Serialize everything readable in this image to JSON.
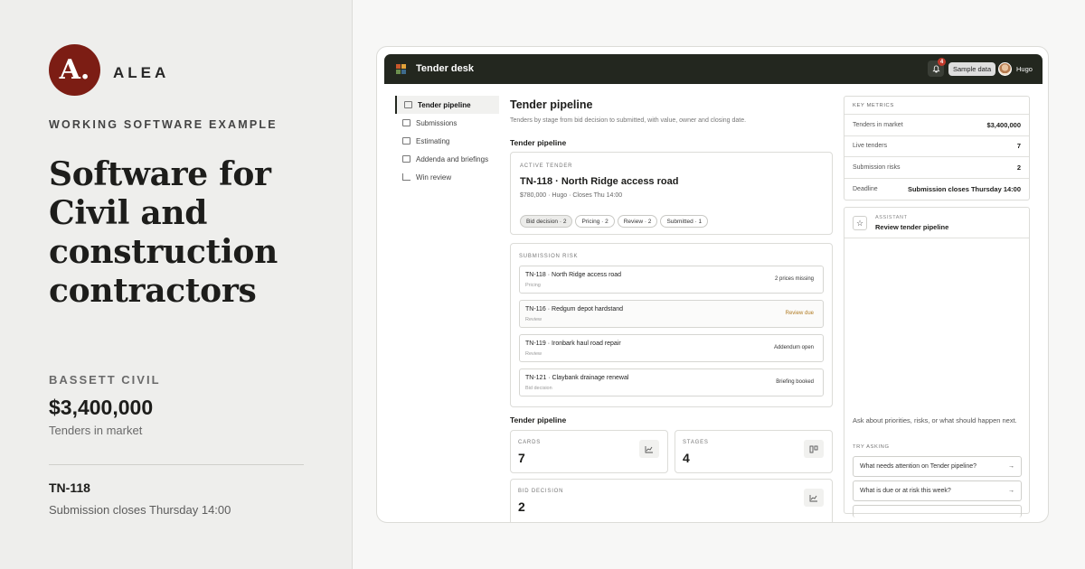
{
  "promo": {
    "logo_letter": "A.",
    "brand": "ALEA",
    "eyebrow": "WORKING SOFTWARE EXAMPLE",
    "headline": "Software for Civil and construction contractors",
    "company": "BASSETT CIVIL",
    "value": "$3,400,000",
    "value_label": "Tenders in market",
    "tender_id": "TN-118",
    "tender_deadline": "Submission closes Thursday 14:00"
  },
  "app": {
    "title": "Tender desk",
    "notification_count": "4",
    "sample_label": "Sample data",
    "user_name": "Hugo",
    "brand_colors": [
      "#c9572b",
      "#e2a23a",
      "#6c8f4e",
      "#3e6a8c"
    ]
  },
  "nav": {
    "items": [
      {
        "label": "Tender pipeline",
        "icon": "board-icon",
        "active": true
      },
      {
        "label": "Submissions",
        "icon": "inbox-icon"
      },
      {
        "label": "Estimating",
        "icon": "table-icon"
      },
      {
        "label": "Addenda and briefings",
        "icon": "document-icon"
      },
      {
        "label": "Win review",
        "icon": "chart-icon"
      }
    ]
  },
  "main": {
    "title": "Tender pipeline",
    "subtitle": "Tenders by stage from bid decision to submitted, with value, owner and closing date.",
    "section1": "Tender pipeline",
    "active": {
      "label": "ACTIVE TENDER",
      "title": "TN-118 · North Ridge access road",
      "meta": "$780,000 · Hugo · Closes Thu 14:00",
      "chips": [
        "Bid decision · 2",
        "Pricing · 2",
        "Review · 2",
        "Submitted · 1"
      ]
    },
    "risk": {
      "label": "SUBMISSION RISK",
      "rows": [
        {
          "name": "TN-118 · North Ridge access road",
          "stage": "Pricing",
          "status": "2 prices missing"
        },
        {
          "name": "TN-116 · Redgum depot hardstand",
          "stage": "Review",
          "status": "Review due"
        },
        {
          "name": "TN-119 · Ironbark haul road repair",
          "stage": "Review",
          "status": "Addendum open"
        },
        {
          "name": "TN-121 · Claybank drainage renewal",
          "stage": "Bid decision",
          "status": "Briefing booked"
        }
      ]
    },
    "section2": "Tender pipeline",
    "stats": [
      {
        "label": "CARDS",
        "value": "7",
        "icon": "chart-icon"
      },
      {
        "label": "STAGES",
        "value": "4",
        "icon": "board-icon"
      },
      {
        "label": "BID DECISION",
        "value": "2",
        "icon": "chart-icon"
      }
    ]
  },
  "metrics": {
    "header": "KEY METRICS",
    "rows": [
      {
        "label": "Tenders in market",
        "value": "$3,400,000"
      },
      {
        "label": "Live tenders",
        "value": "7"
      },
      {
        "label": "Submission risks",
        "value": "2"
      },
      {
        "label": "Deadline",
        "value": "Submission closes Thursday 14:00"
      }
    ]
  },
  "assistant": {
    "label": "ASSISTANT",
    "title": "Review tender pipeline",
    "prompt": "Ask about priorities, risks, or what should happen next.",
    "try_label": "TRY ASKING",
    "suggestions": [
      "What needs attention on Tender pipeline?",
      "What is due or at risk this week?"
    ],
    "arrow": "→"
  }
}
